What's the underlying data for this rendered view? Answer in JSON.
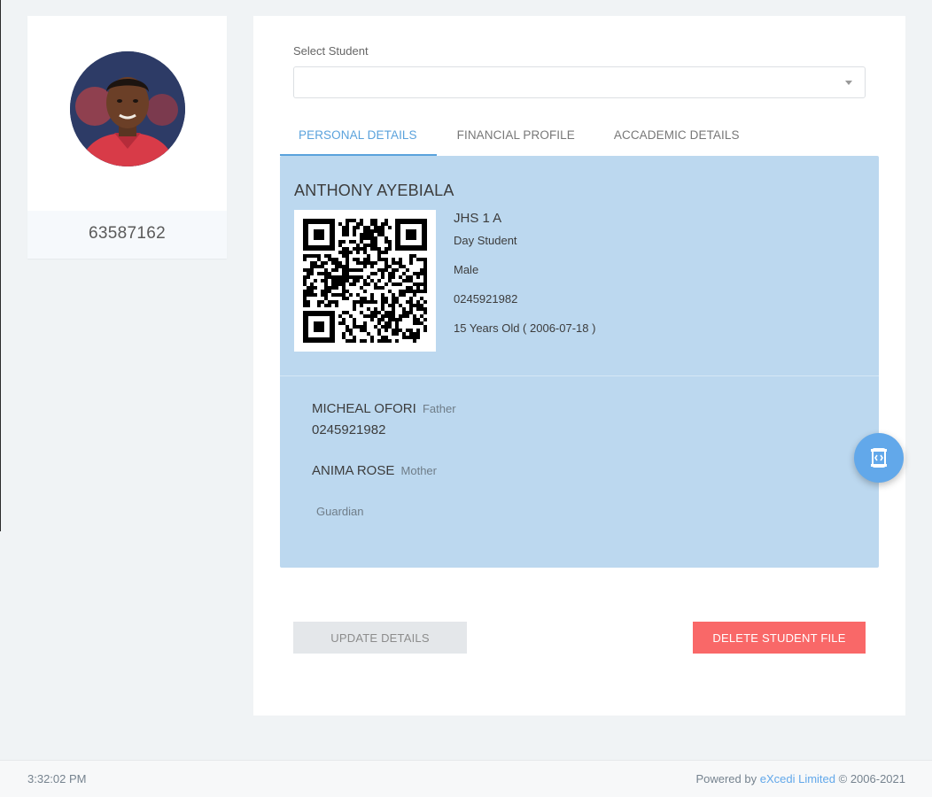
{
  "profile": {
    "student_id": "63587162"
  },
  "form": {
    "select_label": "Select Student",
    "select_value": ""
  },
  "tabs": [
    {
      "label": "PERSONAL DETAILS",
      "active": true
    },
    {
      "label": "FINANCIAL PROFILE",
      "active": false
    },
    {
      "label": "ACCADEMIC DETAILS",
      "active": false
    }
  ],
  "student": {
    "name": "ANTHONY AYEBIALA",
    "class": "JHS 1 A",
    "type": "Day Student",
    "gender": "Male",
    "phone": "0245921982",
    "age": "15 Years Old ( 2006-07-18 )"
  },
  "parents": {
    "father": {
      "name": "MICHEAL OFORI",
      "relation": "Father",
      "phone": "0245921982"
    },
    "mother": {
      "name": "ANIMA ROSE",
      "relation": "Mother"
    },
    "guardian": {
      "relation": "Guardian"
    }
  },
  "actions": {
    "update_label": "UPDATE DETAILS",
    "delete_label": "DELETE STUDENT FILE"
  },
  "footer": {
    "time": "3:32:02 PM",
    "powered_by": "Powered by",
    "company": "eXcedi Limited",
    "copyright": "© 2006-2021"
  },
  "colors": {
    "accent": "#5aa2dc",
    "panel": "#bcd8ef",
    "danger": "#f96868",
    "fab": "#62a8ea"
  },
  "icons": {
    "fab": "code-toggle-icon",
    "select_caret": "caret-down-icon"
  }
}
